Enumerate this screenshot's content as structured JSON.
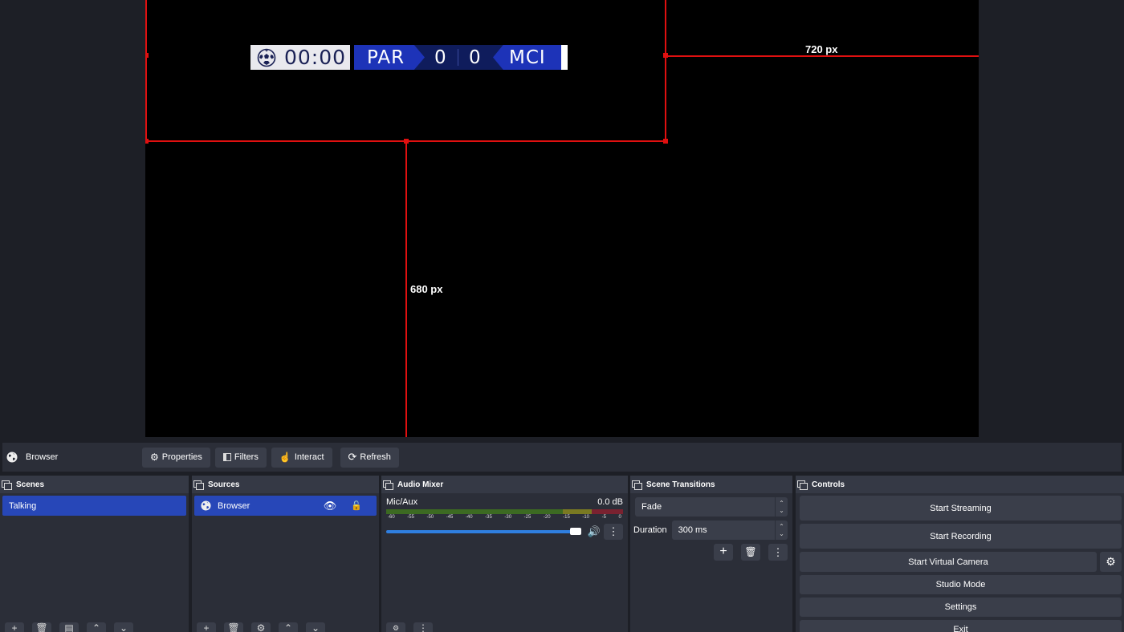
{
  "preview": {
    "width_label": "720 px",
    "height_label": "680 px"
  },
  "scoreboard": {
    "time": "00:00",
    "home_team": "PAR",
    "home_score": "0",
    "away_score": "0",
    "away_team": "MCI",
    "colors": {
      "bar": "#0f1c5c",
      "team": "#1d33b8",
      "clock_bg": "#e9e9ee"
    }
  },
  "source_toolbar": {
    "source_name": "Browser",
    "properties_label": "Properties",
    "filters_label": "Filters",
    "interact_label": "Interact",
    "refresh_label": "Refresh"
  },
  "scenes": {
    "title": "Scenes",
    "items": [
      "Talking"
    ]
  },
  "sources": {
    "title": "Sources",
    "items": [
      "Browser"
    ]
  },
  "audio_mixer": {
    "title": "Audio Mixer",
    "channel": "Mic/Aux",
    "level": "0.0 dB",
    "ticks": [
      "-60",
      "-55",
      "-50",
      "-45",
      "-40",
      "-35",
      "-30",
      "-25",
      "-20",
      "-15",
      "-10",
      "-5",
      "0"
    ],
    "volume_fraction": 1.0
  },
  "scene_transitions": {
    "title": "Scene Transitions",
    "transition": "Fade",
    "duration_label": "Duration",
    "duration_value": "300 ms"
  },
  "controls": {
    "title": "Controls",
    "start_streaming": "Start Streaming",
    "start_recording": "Start Recording",
    "start_virtual_camera": "Start Virtual Camera",
    "studio_mode": "Studio Mode",
    "settings": "Settings",
    "exit": "Exit"
  },
  "colors": {
    "accent": "#2747b8",
    "guide": "#e01010",
    "panel": "#2b2e38"
  }
}
